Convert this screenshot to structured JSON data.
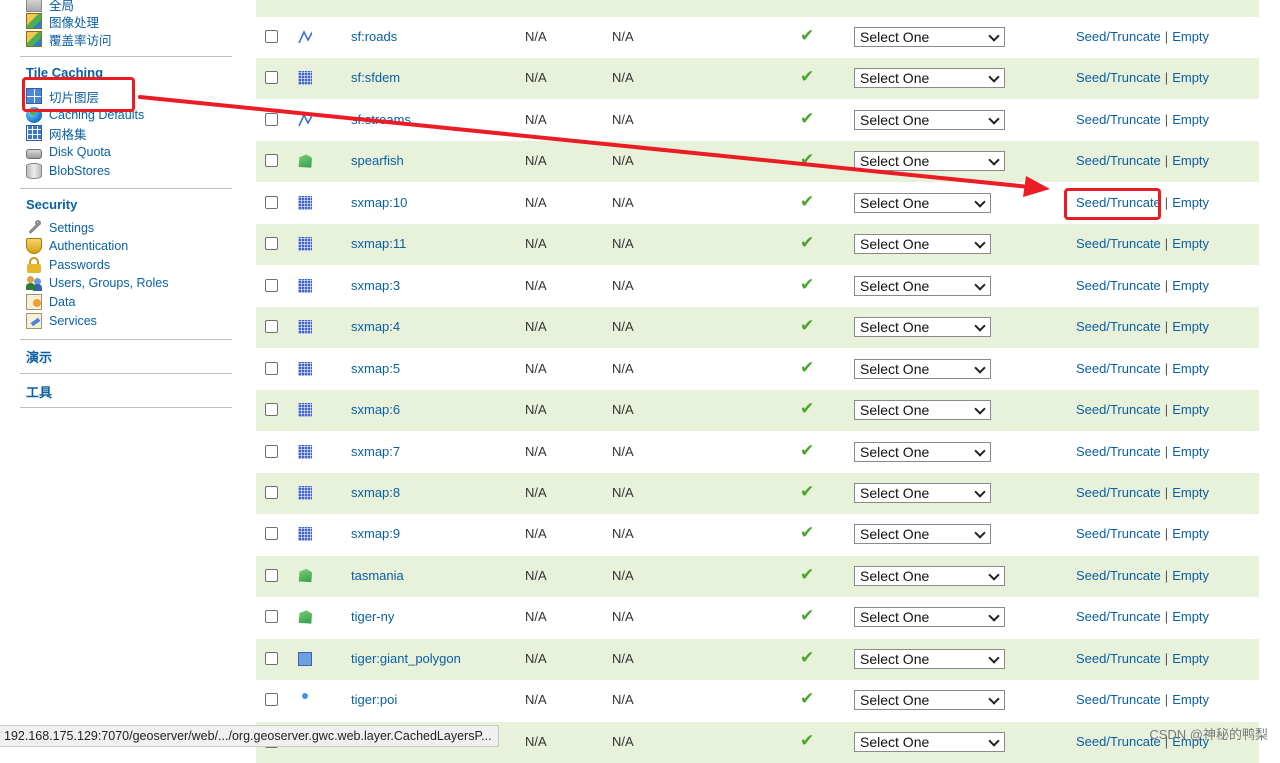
{
  "sidebar": {
    "top_items": [
      {
        "label": "全局",
        "icon": "settings-icon"
      },
      {
        "label": "图像处理",
        "icon": "image-icon"
      },
      {
        "label": "覆盖率访问",
        "icon": "coverage-icon"
      }
    ],
    "tile_caching": {
      "heading": "Tile Caching",
      "items": [
        {
          "label": "切片图层",
          "icon": "grid-icon"
        },
        {
          "label": "Caching Defaults",
          "icon": "globe-icon"
        },
        {
          "label": "网格集",
          "icon": "gridset-icon"
        },
        {
          "label": "Disk Quota",
          "icon": "disk-icon"
        },
        {
          "label": "BlobStores",
          "icon": "database-icon"
        }
      ]
    },
    "security": {
      "heading": "Security",
      "items": [
        {
          "label": "Settings",
          "icon": "wrench-icon"
        },
        {
          "label": "Authentication",
          "icon": "shield-icon"
        },
        {
          "label": "Passwords",
          "icon": "lock-icon"
        },
        {
          "label": "Users, Groups, Roles",
          "icon": "users-icon"
        },
        {
          "label": "Data",
          "icon": "data-icon"
        },
        {
          "label": "Services",
          "icon": "services-icon"
        }
      ]
    },
    "demo_heading": "演示",
    "tools_heading": "工具"
  },
  "layers": {
    "na": "N/A",
    "select_placeholder": "Select One",
    "seed_label": "Seed/Truncate",
    "empty_label": "Empty",
    "separator": "|",
    "rows": [
      {
        "name": "sf:roads",
        "type": "line"
      },
      {
        "name": "sf:sfdem",
        "type": "raster"
      },
      {
        "name": "sf:streams",
        "type": "line"
      },
      {
        "name": "spearfish",
        "type": "polygon"
      },
      {
        "name": "sxmap:10",
        "type": "raster"
      },
      {
        "name": "sxmap:11",
        "type": "raster"
      },
      {
        "name": "sxmap:3",
        "type": "raster"
      },
      {
        "name": "sxmap:4",
        "type": "raster"
      },
      {
        "name": "sxmap:5",
        "type": "raster"
      },
      {
        "name": "sxmap:6",
        "type": "raster"
      },
      {
        "name": "sxmap:7",
        "type": "raster"
      },
      {
        "name": "sxmap:8",
        "type": "raster"
      },
      {
        "name": "sxmap:9",
        "type": "raster"
      },
      {
        "name": "tasmania",
        "type": "polygon"
      },
      {
        "name": "tiger-ny",
        "type": "polygon"
      },
      {
        "name": "tiger:giant_polygon",
        "type": "big-polygon"
      },
      {
        "name": "tiger:poi",
        "type": "point"
      },
      {
        "name": "",
        "type": "none"
      }
    ]
  },
  "status_bar": {
    "url": "192.168.175.129:7070/geoserver/web/.../org.geoserver.gwc.web.layer.CachedLayersP..."
  },
  "watermark": "CSDN @神秘的鸭梨",
  "colors": {
    "accent_link": "#0b5fa5",
    "alt_row": "#e8f1d9",
    "highlight": "#ec1c24",
    "check": "#4aa52e"
  }
}
